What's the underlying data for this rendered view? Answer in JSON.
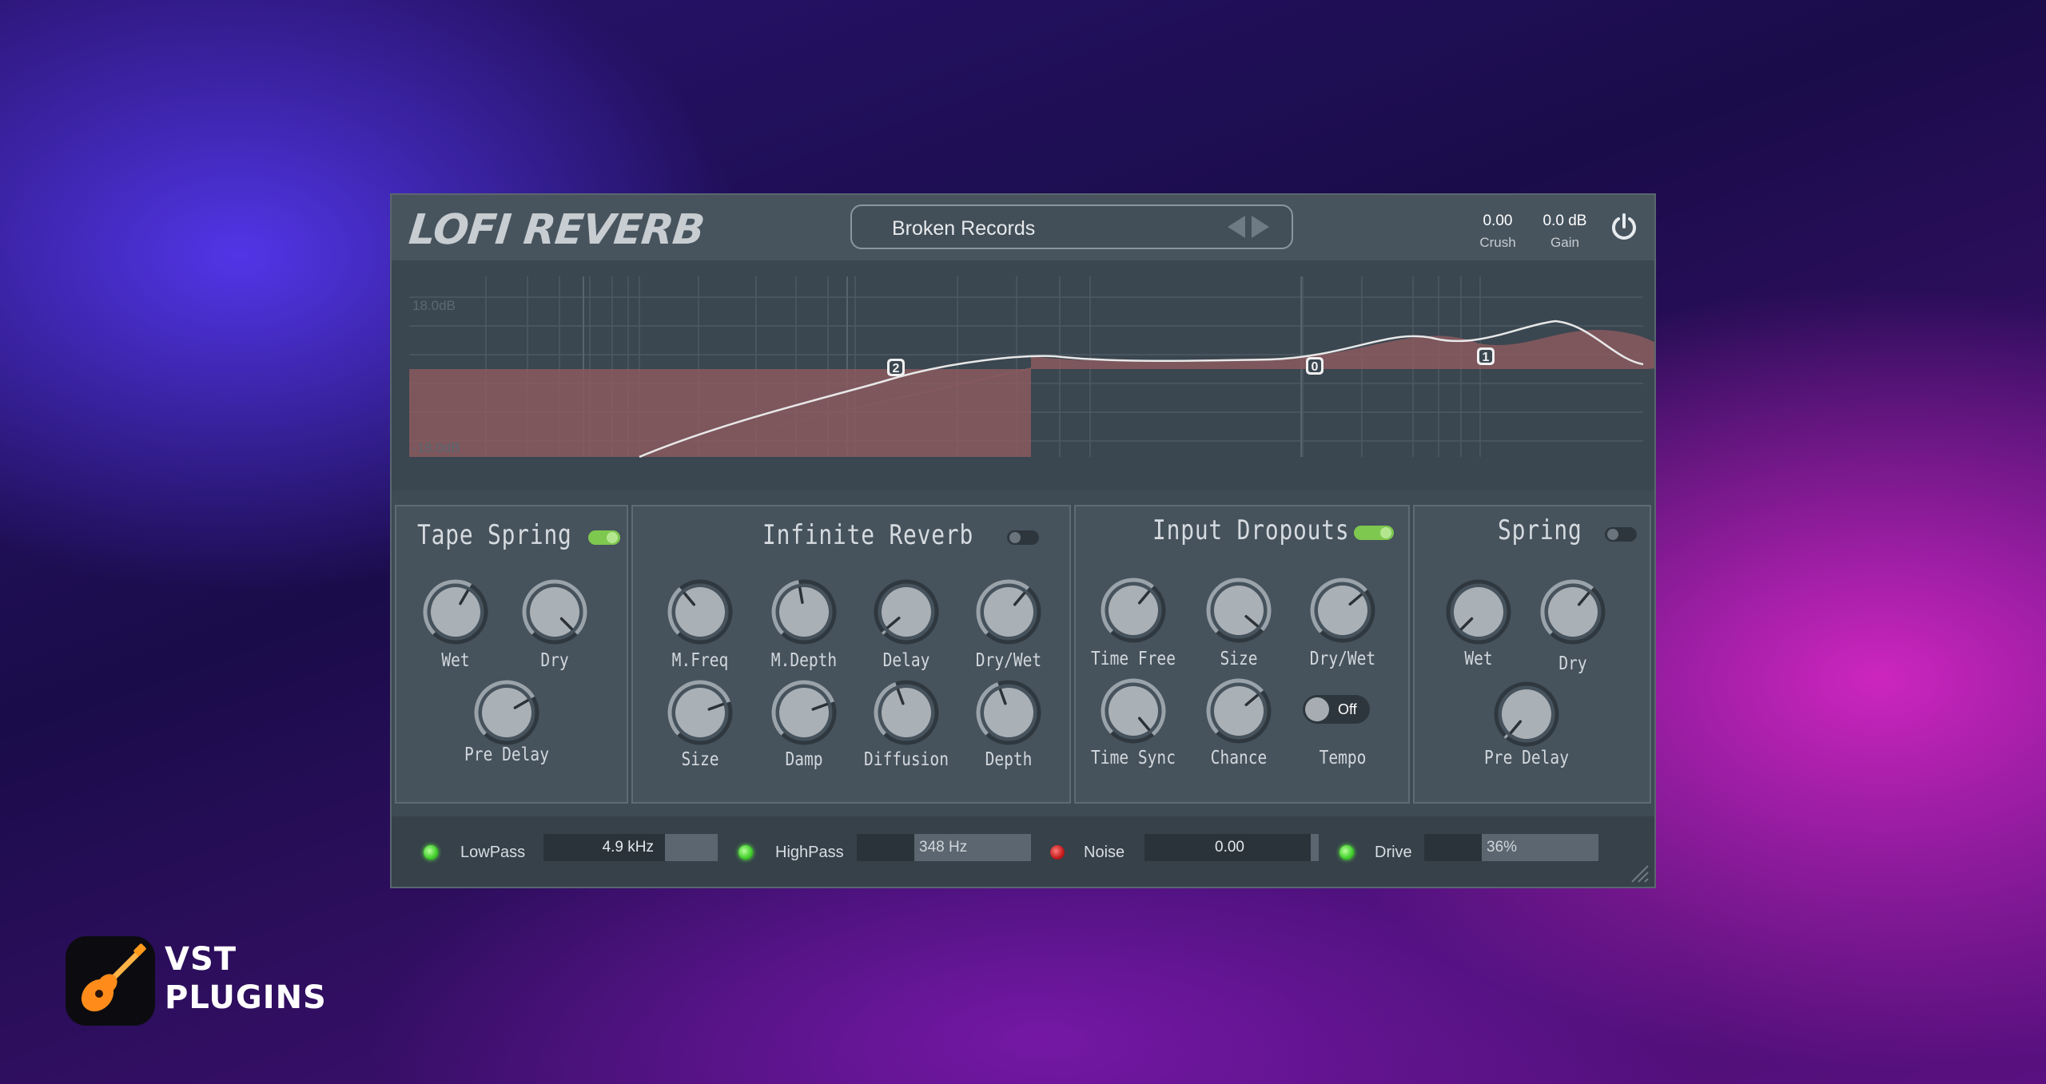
{
  "app": {
    "title": "LOFI REVERB",
    "preset_name": "Broken Records",
    "crush": {
      "value": "0.00",
      "label": "Crush"
    },
    "gain": {
      "value": "0.0 dB",
      "label": "Gain"
    }
  },
  "eq": {
    "top_label": "18.0dB",
    "bottom_label": "-18.0dB",
    "nodes": [
      "2",
      "0",
      "1"
    ],
    "fill_color": "#8a5a5e",
    "curve_color": "#e8e8e8"
  },
  "sections": {
    "tape_spring": {
      "title": "Tape Spring",
      "enabled": true,
      "knobs": [
        "Wet",
        "Dry",
        "Pre Delay"
      ]
    },
    "infinite_reverb": {
      "title": "Infinite Reverb",
      "enabled": false,
      "knobs": [
        "M.Freq",
        "M.Depth",
        "Delay",
        "Dry/Wet",
        "Size",
        "Damp",
        "Diffusion",
        "Depth"
      ]
    },
    "input_dropouts": {
      "title": "Input Dropouts",
      "enabled": true,
      "knobs": [
        "Time Free",
        "Size",
        "Dry/Wet",
        "Time Sync",
        "Chance",
        "Tempo"
      ],
      "tempo_toggle": "Off"
    },
    "spring": {
      "title": "Spring",
      "enabled": false,
      "knobs": [
        "Wet",
        "Dry",
        "Pre Delay"
      ]
    }
  },
  "bottom": {
    "lowpass": {
      "label": "LowPass",
      "value": "4.9 kHz",
      "enabled": true
    },
    "highpass": {
      "label": "HighPass",
      "value": "348 Hz",
      "enabled": true
    },
    "noise": {
      "label": "Noise",
      "value": "0.00",
      "enabled": false
    },
    "drive": {
      "label": "Drive",
      "value": "36%",
      "enabled": true
    }
  },
  "brand": {
    "line1": "VST",
    "line2": "PLUGINS"
  }
}
